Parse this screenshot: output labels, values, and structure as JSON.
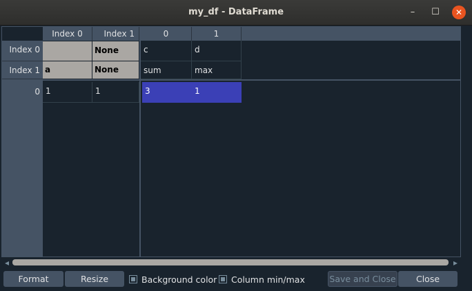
{
  "window": {
    "title": "my_df - DataFrame",
    "minimize": "–",
    "maximize": "☐",
    "close": "✕"
  },
  "index_panel": {
    "col_headers": [
      "Index 0",
      "Index 1"
    ],
    "level_row_headers": [
      "Index 0",
      "Index 1"
    ],
    "level_cells": [
      [
        "",
        "None"
      ],
      [
        "a",
        "None"
      ]
    ],
    "row_headers": [
      "0"
    ],
    "rows": [
      [
        "1",
        "1"
      ]
    ]
  },
  "data_panel": {
    "col_headers": [
      "0",
      "1"
    ],
    "header_levels": [
      [
        "c",
        "d"
      ],
      [
        "sum",
        "max"
      ]
    ],
    "rows": [
      [
        "3",
        "1"
      ]
    ]
  },
  "scrollbar": {
    "left_arrow": "◂",
    "right_arrow": "▸"
  },
  "footer": {
    "format_label": "Format",
    "resize_label": "Resize",
    "background_color_label": "Background color",
    "column_minmax_label": "Column min/max",
    "save_close_label": "Save and Close",
    "close_label": "Close"
  },
  "colors": {
    "selection": "#3b40b6",
    "level_header_bg": "#aaa7a3",
    "window_bg": "#19232d",
    "close_button": "#e95420"
  }
}
